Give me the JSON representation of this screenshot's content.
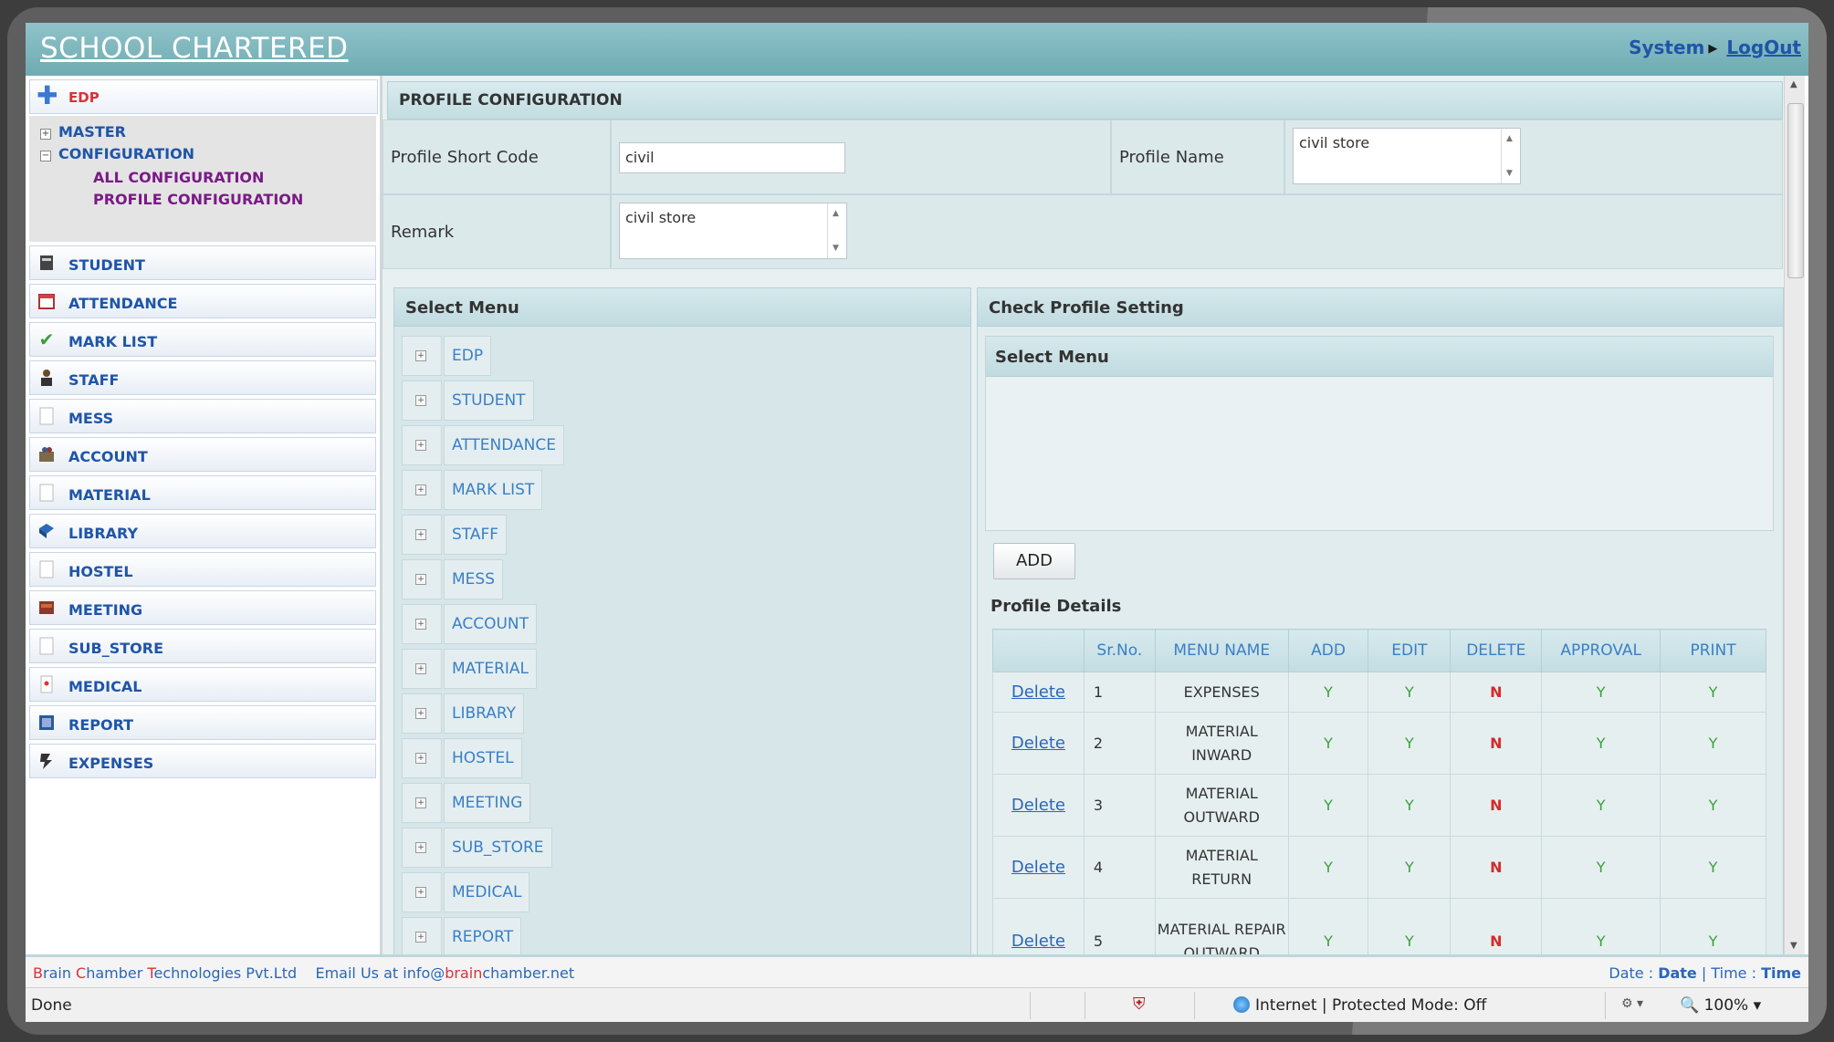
{
  "app": {
    "title": "SCHOOL CHARTERED",
    "system_label": "System",
    "logout_label": "LogOut"
  },
  "sidebar": {
    "active": {
      "label": "EDP",
      "icon": "plus-icon"
    },
    "tree": {
      "master": "MASTER",
      "configuration": "CONFIGURATION",
      "all_configuration": "ALL CONFIGURATION",
      "profile_configuration": "PROFILE CONFIGURATION"
    },
    "items": [
      {
        "label": "STUDENT",
        "icon": "student-icon"
      },
      {
        "label": "ATTENDANCE",
        "icon": "calendar-icon"
      },
      {
        "label": "MARK LIST",
        "icon": "checkmark-icon"
      },
      {
        "label": "STAFF",
        "icon": "staff-icon"
      },
      {
        "label": "MESS",
        "icon": "blank-page-icon"
      },
      {
        "label": "ACCOUNT",
        "icon": "account-icon"
      },
      {
        "label": "MATERIAL",
        "icon": "blank-page-icon"
      },
      {
        "label": "LIBRARY",
        "icon": "book-icon"
      },
      {
        "label": "HOSTEL",
        "icon": "blank-page-icon"
      },
      {
        "label": "MEETING",
        "icon": "meeting-icon"
      },
      {
        "label": "SUB_STORE",
        "icon": "blank-page-icon"
      },
      {
        "label": "MEDICAL",
        "icon": "medical-icon"
      },
      {
        "label": "REPORT",
        "icon": "report-icon"
      },
      {
        "label": "EXPENSES",
        "icon": "expenses-icon"
      }
    ]
  },
  "main": {
    "header": "PROFILE CONFIGURATION",
    "form": {
      "short_code_label": "Profile Short Code",
      "short_code_value": "civil",
      "profile_name_label": "Profile Name",
      "profile_name_value": "civil store",
      "remark_label": "Remark",
      "remark_value": "civil store"
    },
    "select_menu_panel": {
      "title": "Select Menu",
      "items": [
        "EDP",
        "STUDENT",
        "ATTENDANCE",
        "MARK LIST",
        "STAFF",
        "MESS",
        "ACCOUNT",
        "MATERIAL",
        "LIBRARY",
        "HOSTEL",
        "MEETING",
        "SUB_STORE",
        "MEDICAL",
        "REPORT"
      ]
    },
    "check_profile": {
      "title": "Check Profile Setting",
      "select_menu_title": "Select Menu",
      "add_label": "ADD",
      "profile_details_label": "Profile Details",
      "columns": [
        "",
        "Sr.No.",
        "MENU NAME",
        "ADD",
        "EDIT",
        "DELETE",
        "APPROVAL",
        "PRINT"
      ],
      "rows": [
        {
          "action": "Delete",
          "sr": "1",
          "menu": "EXPENSES",
          "add": "Y",
          "edit": "Y",
          "delete": "N",
          "approval": "Y",
          "print": "Y"
        },
        {
          "action": "Delete",
          "sr": "2",
          "menu": "MATERIAL INWARD",
          "add": "Y",
          "edit": "Y",
          "delete": "N",
          "approval": "Y",
          "print": "Y"
        },
        {
          "action": "Delete",
          "sr": "3",
          "menu": "MATERIAL OUTWARD",
          "add": "Y",
          "edit": "Y",
          "delete": "N",
          "approval": "Y",
          "print": "Y"
        },
        {
          "action": "Delete",
          "sr": "4",
          "menu": "MATERIAL RETURN",
          "add": "Y",
          "edit": "Y",
          "delete": "N",
          "approval": "Y",
          "print": "Y"
        },
        {
          "action": "Delete",
          "sr": "5",
          "menu": "MATERIAL REPAIR OUTWARD",
          "add": "Y",
          "edit": "Y",
          "delete": "N",
          "approval": "Y",
          "print": "Y"
        }
      ]
    }
  },
  "footer": {
    "company_pre": "B",
    "company_a": "rain ",
    "company_c": "C",
    "company_b": "hamber ",
    "company_t": "T",
    "company_rest": "echnologies Pvt.Ltd",
    "email_pre": "Email Us at info@",
    "email_brand": "brain",
    "email_post": "chamber.net",
    "date_label": "Date :",
    "date_value": "Date",
    "time_label": "Time :",
    "time_value": "Time"
  },
  "statusbar": {
    "status": "Done",
    "zone": "Internet | Protected Mode: Off",
    "zoom": "100%"
  },
  "colors": {
    "header_teal": "#7ab8bf",
    "link_blue": "#1f55a8",
    "active_red": "#d8323c",
    "yes_green": "#3aa03a",
    "no_red": "#d62a2a"
  }
}
